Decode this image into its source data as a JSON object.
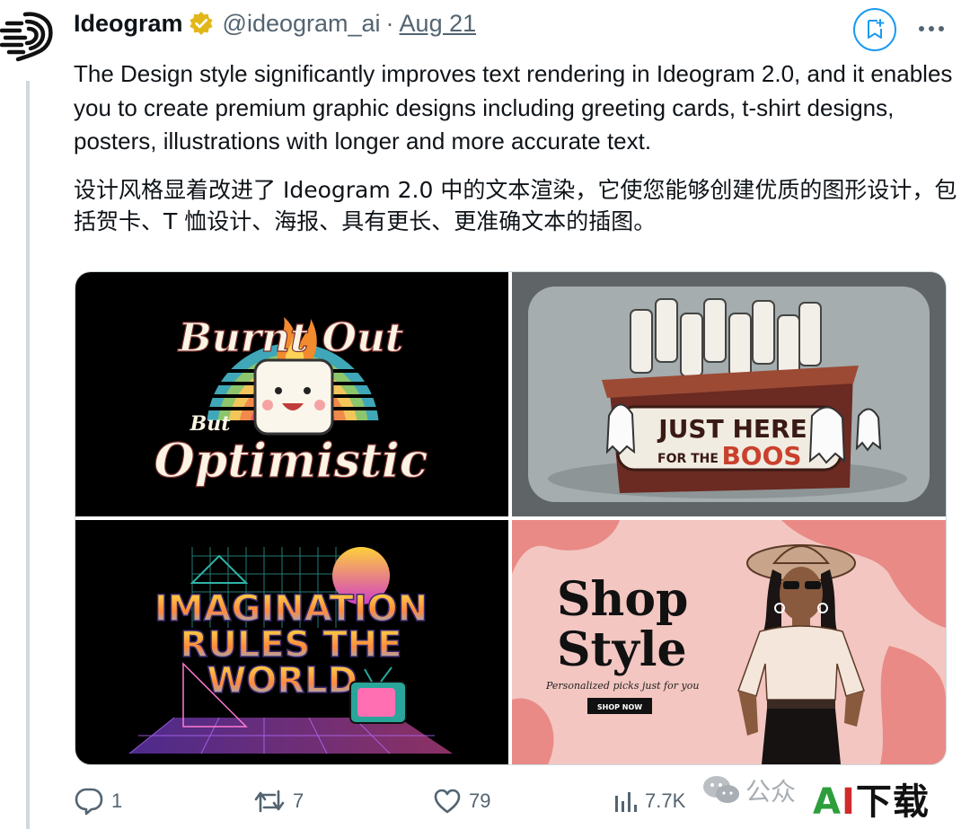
{
  "tweet": {
    "author_name": "Ideogram",
    "handle": "@ideogram_ai",
    "separator": "·",
    "date": "Aug 21",
    "text_en": "The Design style significantly improves text rendering in Ideogram 2.0, and it enables you to create premium graphic designs including greeting cards, t-shirt designs, posters, illustrations with longer and more accurate text.",
    "text_cn": "设计风格显着改进了 Ideogram 2.0 中的文本渲染，它使您能够创建优质的图形设计，包括贺卡、T 恤设计、海报、具有更长、更准确文本的插图。"
  },
  "media": {
    "image1": {
      "line1": "Burnt Out",
      "line2": "But",
      "line3": "Optimistic"
    },
    "image2": {
      "line1": "JUST HERE",
      "line2": "FOR THE",
      "line3": "BOOS"
    },
    "image3": {
      "line1": "IMAGINATION",
      "line2": "RULES THE",
      "line3": "WORLD"
    },
    "image4": {
      "line1": "Shop",
      "line2": "Style",
      "tagline": "Personalized picks just for you",
      "cta": "SHOP NOW"
    }
  },
  "actions": {
    "replies": "1",
    "reposts": "7",
    "likes": "79",
    "views": "7.7K"
  },
  "watermark": {
    "wechat_text": "公众",
    "site_a": "A",
    "site_i": "I",
    "site_rest": "下载"
  },
  "icons": [
    "ideogram-logo-icon",
    "verified-badge-icon",
    "bookmark-icon",
    "more-icon",
    "reply-icon",
    "repost-icon",
    "like-icon",
    "views-icon",
    "wechat-icon"
  ],
  "colors": {
    "accent": "#1d9bf0",
    "verified": "#e2b719",
    "muted": "#536471"
  }
}
